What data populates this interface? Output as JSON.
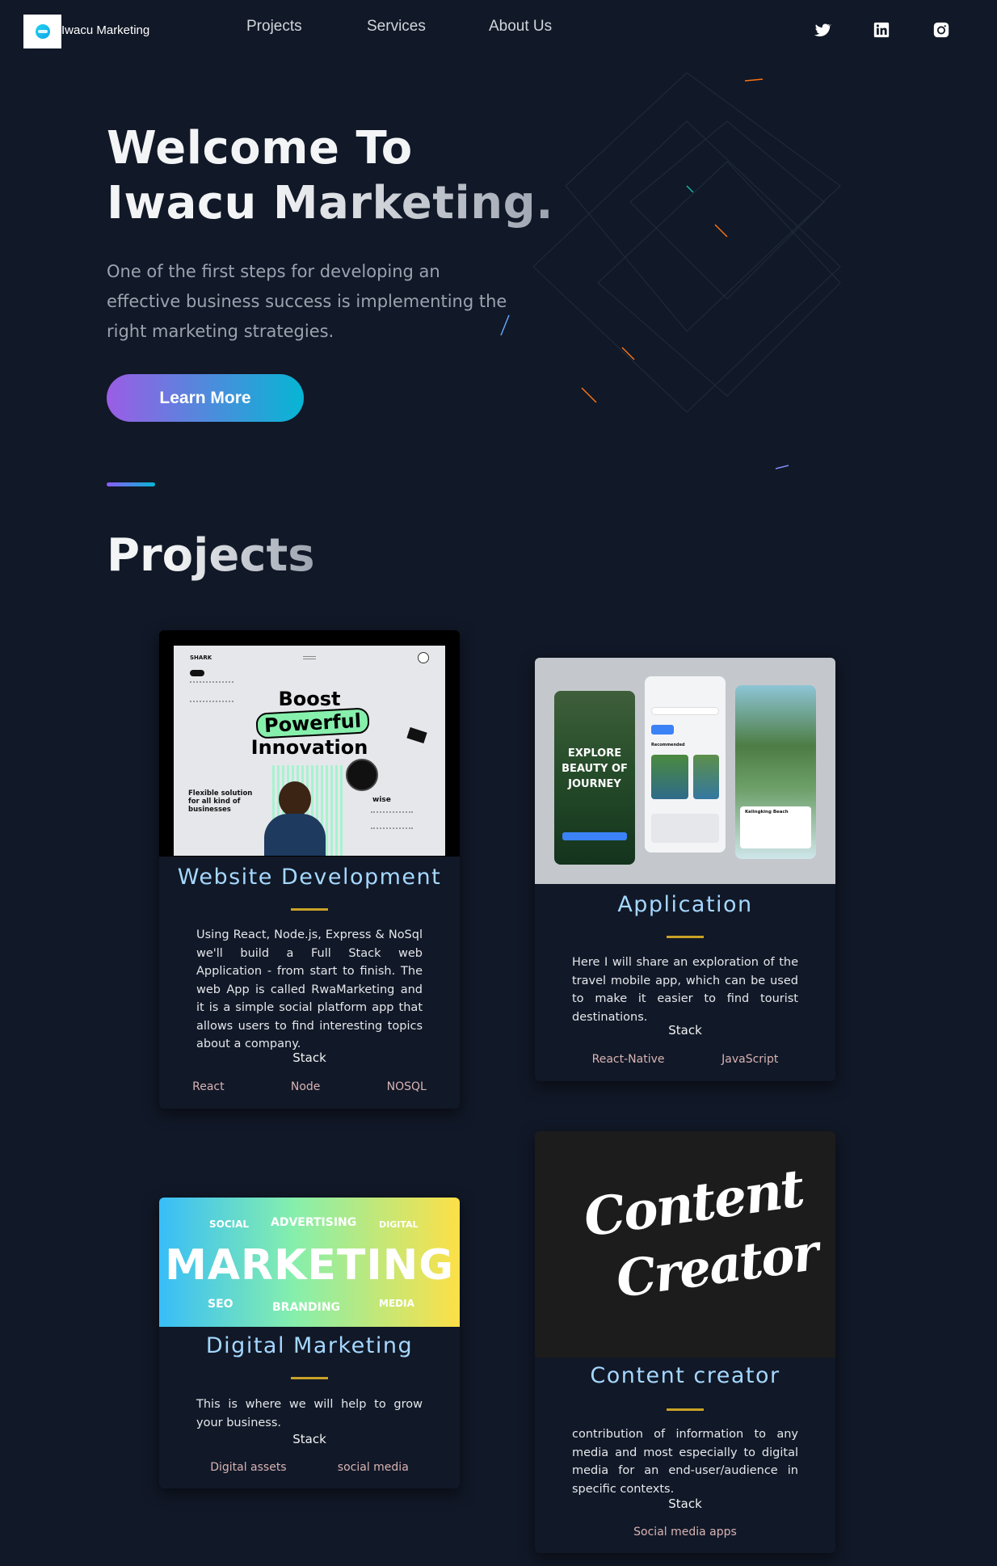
{
  "nav": {
    "logo_text": "Iwacu Marketing",
    "links": [
      "Projects",
      "Services",
      "About Us"
    ],
    "social_icons": [
      "twitter-icon",
      "linkedin-icon",
      "instagram-icon"
    ]
  },
  "hero": {
    "title_line1": "Welcome To",
    "title_line2": "Iwacu Marketing.",
    "subtitle": "One of the first steps for developing an effective business success is implementing the right marketing strategies.",
    "button_label": "Learn More"
  },
  "projects": {
    "heading": "Projects",
    "stack_label": "Stack",
    "cards": [
      {
        "title": "Website Development",
        "description": "Using React, Node.js, Express & NoSql we'll build a Full Stack web Application - from start to finish. The web App is called RwaMarketing and it is a simple social platform app that allows users to find interesting topics about a company.",
        "tags": [
          "React",
          "Node",
          "NOSQL"
        ],
        "image": {
          "brand": "SHARK",
          "headline": [
            "Boost",
            "Powerful",
            "Innovation"
          ],
          "side_text": "Flexible solution for all kind of businesses",
          "wise": "wise"
        }
      },
      {
        "title": "Application",
        "description": "Here I will share an exploration of the travel mobile app, which can be used to make it easier to find tourist destinations.",
        "tags": [
          "React-Native",
          "JavaScript"
        ],
        "image": {
          "phone_text": "EXPLORE BEAUTY OF JOURNEY",
          "recommended": "Recommended",
          "destination": "Kelingking Beach"
        }
      },
      {
        "title": "Digital Marketing",
        "description": "This is where we will help to grow your business.",
        "tags": [
          "Digital assets",
          "social media"
        ],
        "image": {
          "big": "MARKETING",
          "words": [
            "SOCIAL",
            "ADVERTISING",
            "DIGITAL",
            "SEO",
            "BRANDING",
            "MEDIA"
          ]
        }
      },
      {
        "title": "Content creator",
        "description": "contribution of information to any media and most especially to digital media for an end-user/audience in specific contexts.",
        "tags": [
          "Social media apps"
        ],
        "image": {
          "line1": "Content",
          "line2": "Creator"
        }
      }
    ]
  },
  "colors": {
    "background": "#111827",
    "accent_purple": "#9b5de5",
    "accent_cyan": "#06b6d4",
    "card_title": "#a5d8ff",
    "bar_gold": "#c9a227"
  }
}
